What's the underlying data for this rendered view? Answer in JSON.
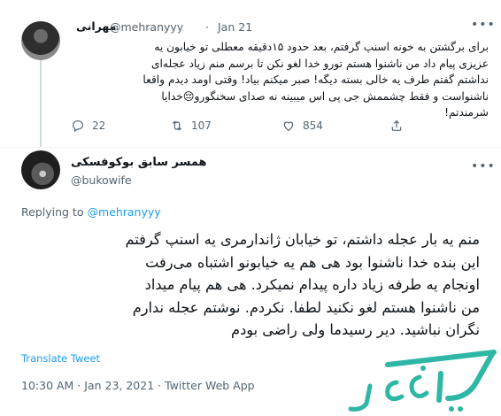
{
  "parent_tweet": {
    "display_name": "مهرانی",
    "handle": "@mehranyyy",
    "separator": "·",
    "date": "Jan 21",
    "body_lines": [
      "برای برگشتن به خونه اسنپ گرفتم، بعد حدود ۱۵دقیقه معطلی تو خیابون یه",
      "عزیزی پیام داد من ناشنوا هستم تورو خدا لغو نکن تا برسم منم زیاد عجله‌ای",
      "نداشتم گفتم طرف یه خالی بسته دیگه! صبر میکنم بیاد! وقتی اومد دیدم واقعا",
      "ناشنواست و فقط چشممش جی پی اس میبینه نه صدای سخنگورو😔خدایا",
      "شرمندتم!"
    ],
    "actions": {
      "reply_count": "22",
      "retweet_count": "107",
      "like_count": "854"
    }
  },
  "main_tweet": {
    "display_name": "همسر سابق بوکوفسکی",
    "handle": "@bukowife",
    "replying_prefix": "Replying to",
    "replying_to": "@mehranyyy",
    "body_lines": [
      "منم یه بار عجله داشتم، تو خیابان ژاندارمری یه اسنپ گرفتم",
      "این بنده خدا ناشنوا بود هی هم یه خیابونو اشتباه می‌رفت",
      "اونجام یه طرفه زیاد داره پیدام نمیکرد. هی هم پیام میداد",
      "من ناشنوا هستم لغو نکنید لطفا. نکردم. نوشتم عجله ندارم",
      "نگران نباشید. دیر رسیدما ولی راضی بودم"
    ],
    "translate_label": "Translate Tweet",
    "meta": "10:30 AM · Jan 23, 2021 · Twitter Web App"
  },
  "more_icon": "more-horizontal-icon",
  "colors": {
    "link": "#1d9bf0",
    "secondary_text": "#536471",
    "divider": "#eff3f4",
    "watermark_teal": "#2fb7a6"
  }
}
